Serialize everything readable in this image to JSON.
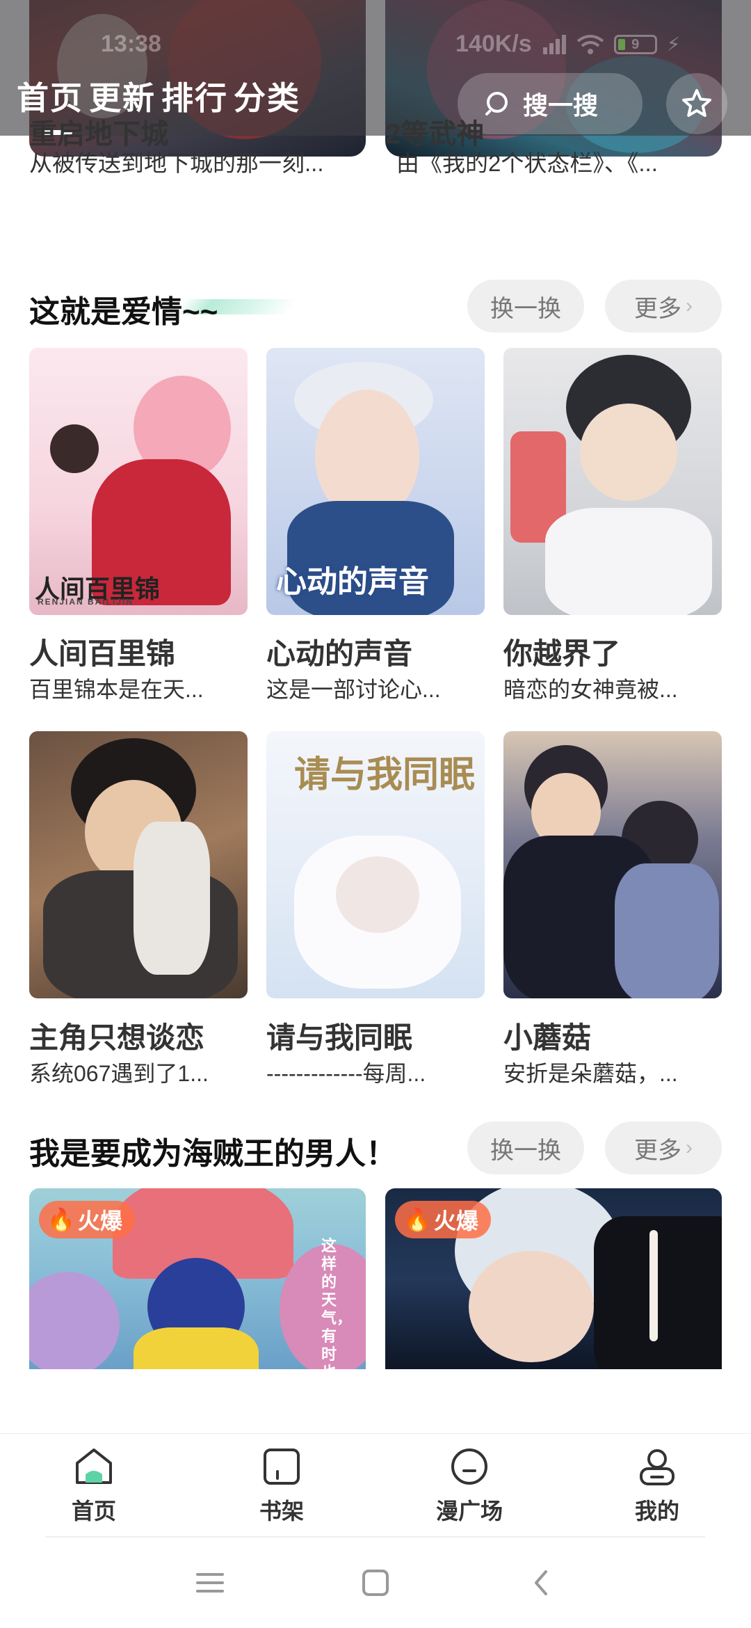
{
  "status_bar": {
    "time": "13:38",
    "network_speed": "140K/s",
    "battery": "9"
  },
  "top_nav": {
    "tabs": [
      {
        "label": "首页",
        "active": true
      },
      {
        "label": "更新",
        "active": false
      },
      {
        "label": "排行",
        "active": false
      },
      {
        "label": "分类",
        "active": false
      }
    ],
    "search_label": "搜一搜"
  },
  "top_row": [
    {
      "title": "重启地下城",
      "desc": "从被传送到地下城的那一刻..."
    },
    {
      "title": "2等武神",
      "desc": "由《我的2个状态栏》、《..."
    }
  ],
  "section_love": {
    "title": "这就是爱情~~",
    "refresh_label": "换一换",
    "more_label": "更多",
    "items": [
      {
        "title": "人间百里锦",
        "desc": "百里锦本是在天...",
        "cover_text": "人间百里锦",
        "cover_sub": "RENJIAN BAILIJIN"
      },
      {
        "title": "心动的声音",
        "desc": "这是一部讨论心...",
        "cover_text": "心动的声音"
      },
      {
        "title": "你越界了",
        "desc": "暗恋的女神竟被..."
      },
      {
        "title": "主角只想谈恋",
        "desc": "系统067遇到了1..."
      },
      {
        "title": "请与我同眠",
        "desc": "-------------每周...",
        "cover_text": "请与我同眠"
      },
      {
        "title": "小蘑菇",
        "desc": "安折是朵蘑菇，..."
      }
    ]
  },
  "section_pirate": {
    "title": "我是要成为海贼王的男人！",
    "refresh_label": "换一换",
    "more_label": "更多",
    "items": [
      {
        "badge": "火爆",
        "cover_text": "这样的天气，有时也挺不错呢。"
      },
      {
        "badge": "火爆"
      }
    ]
  },
  "bottom_nav": {
    "items": [
      {
        "label": "首页",
        "icon": "home-icon"
      },
      {
        "label": "书架",
        "icon": "bookshelf-icon"
      },
      {
        "label": "漫广场",
        "icon": "plaza-icon"
      },
      {
        "label": "我的",
        "icon": "profile-icon"
      }
    ]
  },
  "colors": {
    "accent_green": "#5fd3a8",
    "pill_bg": "#efefef",
    "hot_badge": "#ff6e46"
  }
}
